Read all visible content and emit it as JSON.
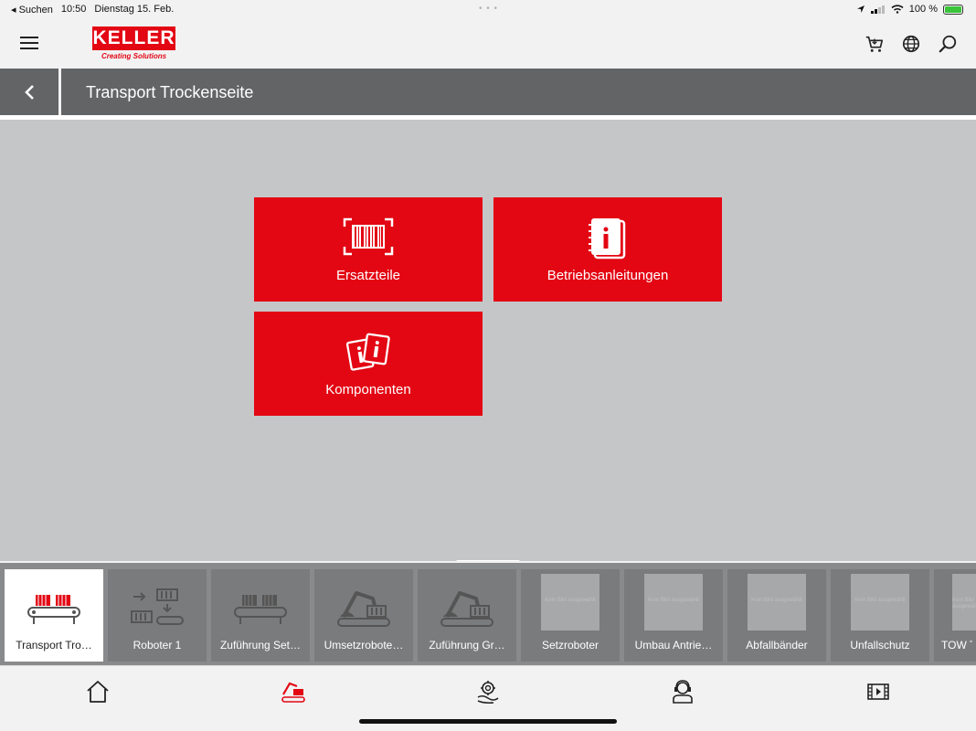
{
  "status_bar": {
    "back_app": "◂ Suchen",
    "time": "10:50",
    "date": "Dienstag 15. Feb.",
    "battery": "100 %"
  },
  "header": {
    "logo_text": "KELLER",
    "logo_tagline": "Creating Solutions",
    "icons": [
      "menu-icon",
      "cart-icon",
      "globe-icon",
      "search-icon"
    ]
  },
  "title_bar": {
    "title": "Transport Trockenseite"
  },
  "tiles": [
    {
      "label": "Ersatzteile",
      "icon": "barcode-icon"
    },
    {
      "label": "Betriebsanleitungen",
      "icon": "manual-info-icon"
    },
    {
      "label": "Komponenten",
      "icon": "components-info-icon"
    }
  ],
  "strip": {
    "no_image_text": "Kein Bild ausgewählt",
    "items": [
      {
        "label": "Transport Tro…",
        "active": true,
        "image": "conveyor"
      },
      {
        "label": "Roboter 1",
        "active": false,
        "image": "robot-transfer"
      },
      {
        "label": "Zuführung Set…",
        "active": false,
        "image": "conveyor"
      },
      {
        "label": "Umsetzrobote…",
        "active": false,
        "image": "excavator"
      },
      {
        "label": "Zuführung Gr…",
        "active": false,
        "image": "excavator"
      },
      {
        "label": "Setzroboter",
        "active": false,
        "image": "none"
      },
      {
        "label": "Umbau Antrie…",
        "active": false,
        "image": "none"
      },
      {
        "label": "Abfallbänder",
        "active": false,
        "image": "none"
      },
      {
        "label": "Unfallschutz",
        "active": false,
        "image": "none"
      },
      {
        "label": "TOW T",
        "active": false,
        "image": "none"
      }
    ]
  },
  "tabbar": {
    "tabs": [
      "home-icon",
      "machine-icon",
      "service-icon",
      "support-icon",
      "video-icon"
    ],
    "active_tab": "machine-icon"
  },
  "colors": {
    "brand_red": "#e30613",
    "title_bar": "#636466",
    "content_bg": "#c5c6c8",
    "strip_bg": "#898a8c"
  }
}
